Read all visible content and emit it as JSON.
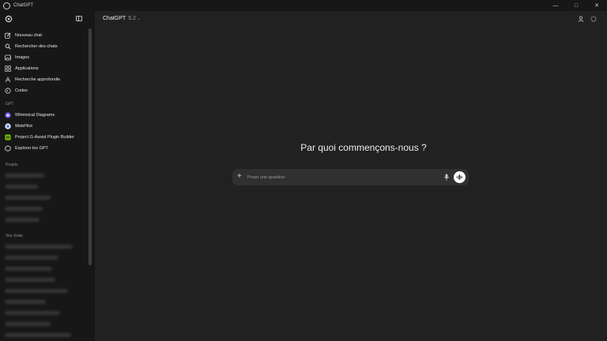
{
  "window": {
    "title": "ChatGPT"
  },
  "sidebar": {
    "nav": [
      {
        "label": "Nouveau chat",
        "icon": "edit-icon"
      },
      {
        "label": "Rechercher des chats",
        "icon": "search-icon"
      },
      {
        "label": "Images",
        "icon": "image-icon"
      },
      {
        "label": "Applications",
        "icon": "apps-icon"
      },
      {
        "label": "Recherche approfondie",
        "icon": "deep-research-icon"
      },
      {
        "label": "Codex",
        "icon": "codex-icon"
      }
    ],
    "gpt_section": "GPT",
    "gpts": [
      {
        "label": "Whimsical Diagrams",
        "icon": "whimsical-icon",
        "color": "#7b5cff"
      },
      {
        "label": "WebPilot",
        "icon": "webpilot-icon",
        "color": "#5a8cff"
      },
      {
        "label": "Project G-Assist Plugin Builder",
        "icon": "g-assist-icon",
        "color": "#76b900"
      },
      {
        "label": "Explorer les GPT",
        "icon": "explore-icon"
      }
    ],
    "projects_section": "Projets",
    "chats_section": "Vos chats"
  },
  "header": {
    "model": "ChatGPT",
    "version": "5.2"
  },
  "main": {
    "heading": "Par quoi commençons-nous ?"
  },
  "composer": {
    "placeholder": "Poser une question"
  }
}
